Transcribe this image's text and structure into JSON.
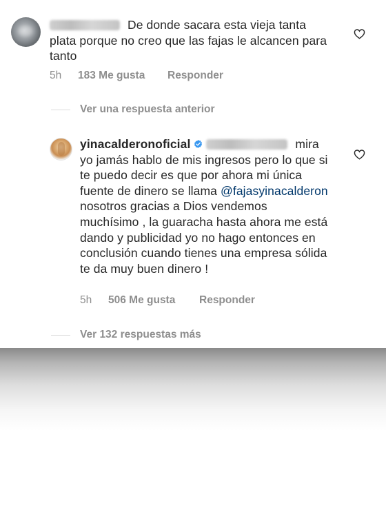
{
  "comments": [
    {
      "username_redacted": true,
      "text": "De donde sacara esta vieja tanta plata porque no creo que las fajas le alcancen para tanto",
      "time": "5h",
      "likes": "183 Me gusta",
      "reply_label": "Responder",
      "avatar_icon": "user-avatar-blurred",
      "like_icon": "heart-outline-icon"
    },
    {
      "username": "yinacalderonoficial",
      "verified_icon": "verified-badge-icon",
      "mention_redacted": true,
      "text_before_link": "mira yo jamás hablo de mis ingresos pero lo que si te puedo decir es que por ahora mi única fuente de dinero se llama",
      "link_mention": "@fajasyinacalderon",
      "text_after_link": "nosotros gracias a Dios vendemos muchísimo , la guaracha hasta ahora me está dando y publicidad yo no hago entonces en conclusión cuando tienes una empresa sólida te da muy buen dinero !",
      "time": "5h",
      "likes": "506 Me gusta",
      "reply_label": "Responder",
      "avatar_icon": "user-avatar",
      "like_icon": "heart-outline-icon"
    }
  ],
  "view_previous_reply": "Ver una respuesta anterior",
  "view_more_replies": "Ver 132 respuestas más",
  "colors": {
    "text": "#262626",
    "secondary": "#8e8e8e",
    "link": "#00376b",
    "verified": "#3897f0",
    "divider": "#dbdbdb"
  }
}
